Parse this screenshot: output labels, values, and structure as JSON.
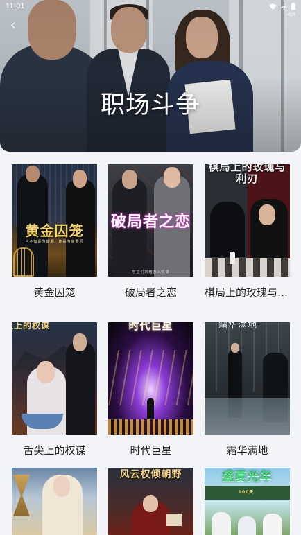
{
  "status_bar": {
    "time": "11:01",
    "icons": [
      "wifi-icon",
      "airplane-icon",
      "battery-icon"
    ]
  },
  "header": {
    "title": "职场斗争",
    "sub_tag": "4p9"
  },
  "dramas": [
    {
      "title": "黄金囚笼",
      "cover_title": "黄金囚笼",
      "cover_caption": "自不知是为婚姻，还是为金而囚"
    },
    {
      "title": "破局者之恋",
      "cover_title": "破局者之恋",
      "cover_caption": "学生们的暗恋入情局"
    },
    {
      "title": "棋局上的玫瑰与利刃",
      "cover_title": "棋局上的玫瑰与利刃",
      "cover_caption": ""
    },
    {
      "title": "舌尖上的权谋",
      "cover_title": "舌尖上的权谋",
      "cover_caption": ""
    },
    {
      "title": "时代巨星",
      "cover_title": "时代巨星",
      "cover_caption": ""
    },
    {
      "title": "霜华满地",
      "cover_title": "霜华满地",
      "cover_caption": ""
    },
    {
      "title": "",
      "cover_title": "",
      "cover_caption": ""
    },
    {
      "title": "",
      "cover_title": "风云权倾朝野",
      "cover_caption": ""
    },
    {
      "title": "",
      "cover_title": "盛夏光年",
      "cover_caption": "100天"
    }
  ],
  "colors": {
    "background": "#f3f4f7",
    "title_text": "#222222"
  }
}
